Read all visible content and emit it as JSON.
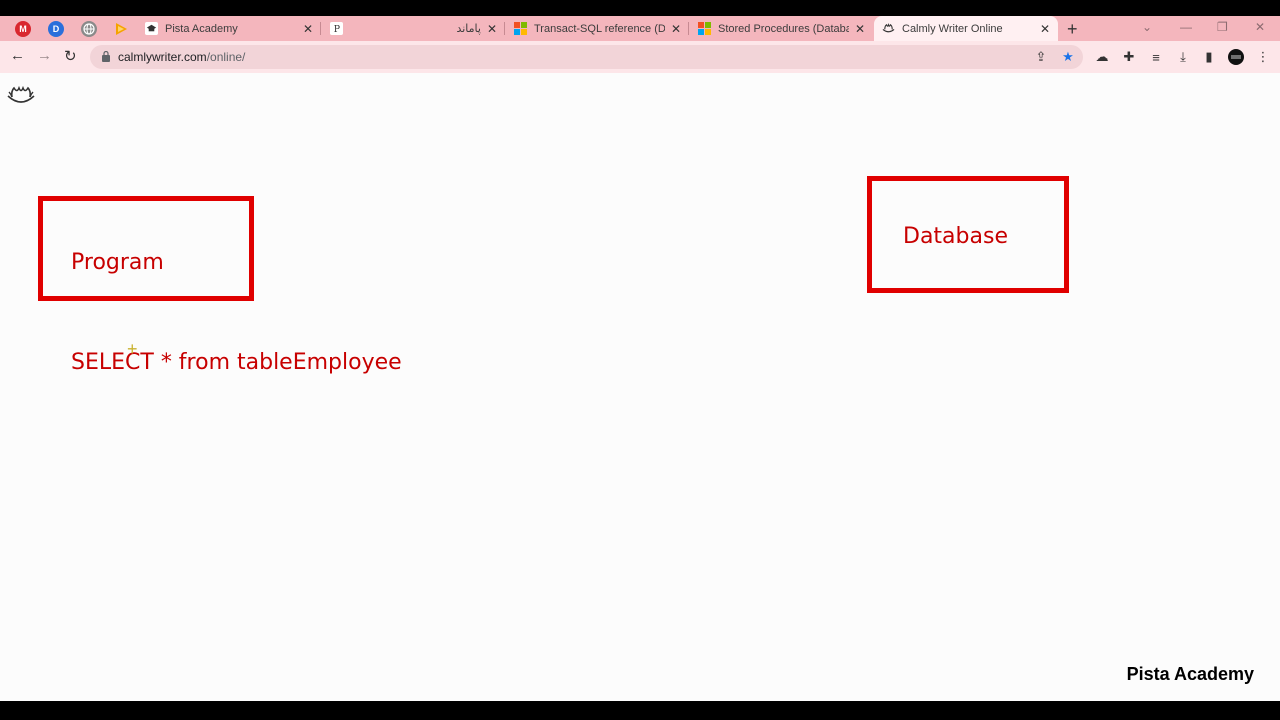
{
  "browser": {
    "pinned": [
      {
        "name": "mega",
        "glyph": "M",
        "color": "#d9272e"
      },
      {
        "name": "d-app",
        "glyph": "D",
        "color": "#2a6fdb"
      },
      {
        "name": "globe",
        "glyph": "",
        "color": "#6e6e6e"
      },
      {
        "name": "orange-app",
        "glyph": "",
        "color": "#f5a300"
      }
    ],
    "tabs": [
      {
        "title": "Pista Academy"
      },
      {
        "title": "پاماند"
      },
      {
        "title": "Transact-SQL reference (Datal"
      },
      {
        "title": "Stored Procedures (Database"
      },
      {
        "title": "Calmly Writer Online"
      }
    ],
    "address": {
      "host": "calmlywriter.com",
      "path": "/online/"
    }
  },
  "canvas": {
    "program_label": "Program",
    "database_label": "Database",
    "sql_text": "SELECT * from tableEmployee",
    "box_color": "#e00000",
    "text_color": "#c70000"
  },
  "watermark": "Pista Academy"
}
